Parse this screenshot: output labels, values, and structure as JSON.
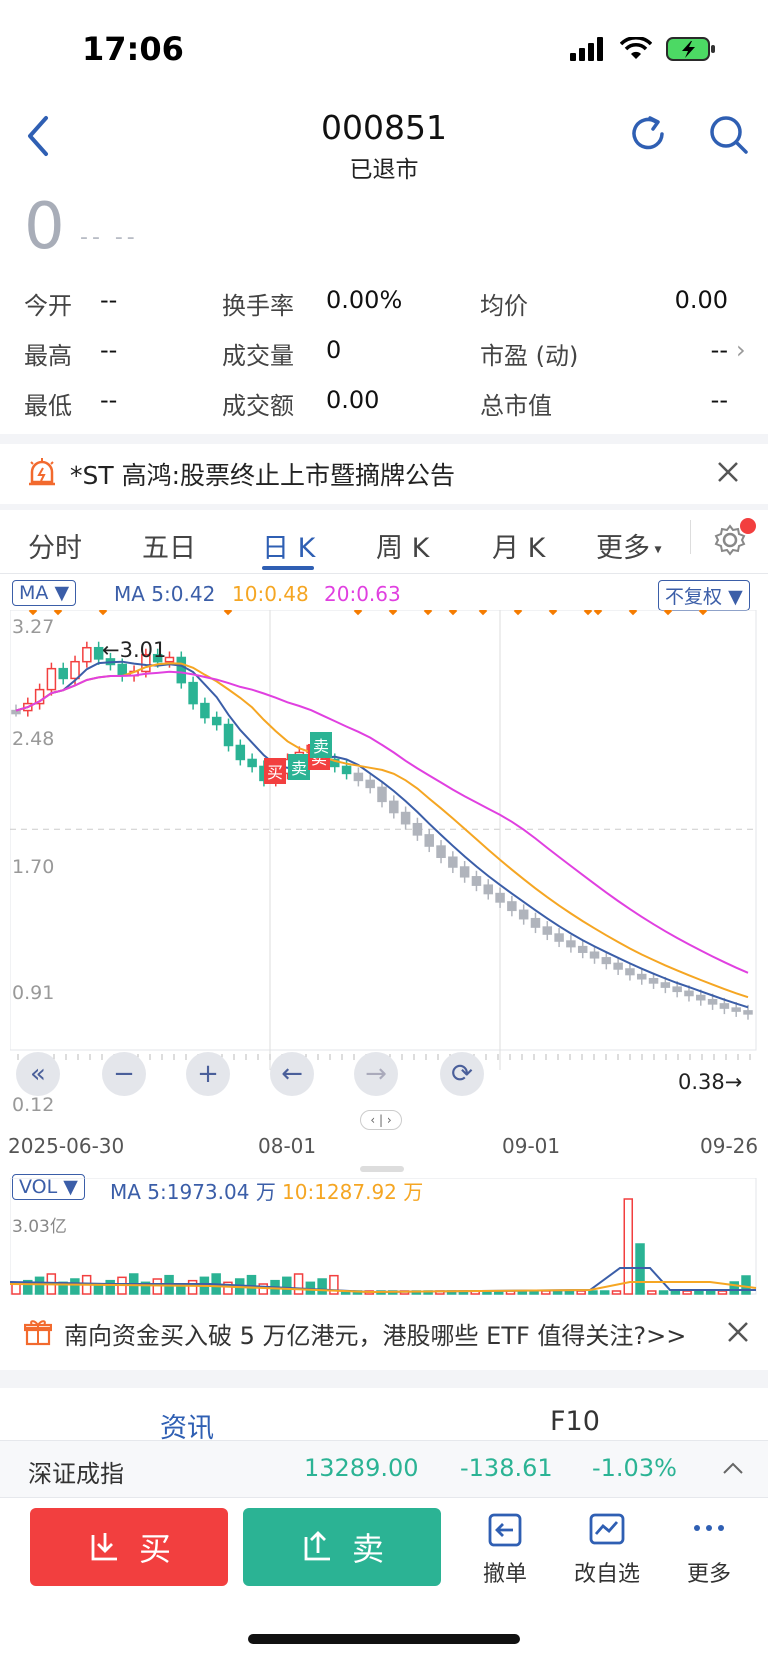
{
  "status": {
    "time": "17:06"
  },
  "header": {
    "code": "000851",
    "status": "已退市"
  },
  "quote": {
    "price": "0",
    "change": "-- --",
    "stats": [
      {
        "label": "今开",
        "value": "--"
      },
      {
        "label": "换手率",
        "value": "0.00%"
      },
      {
        "label": "均价",
        "value": "0.00"
      },
      {
        "label": "最高",
        "value": "--"
      },
      {
        "label": "成交量",
        "value": "0"
      },
      {
        "label": "市盈 (动)",
        "value": "--"
      },
      {
        "label": "最低",
        "value": "--"
      },
      {
        "label": "成交额",
        "value": "0.00"
      },
      {
        "label": "总市值",
        "value": "--"
      }
    ]
  },
  "notice": {
    "text": "*ST 高鸿:股票终止上市暨摘牌公告"
  },
  "tabs": [
    "分时",
    "五日",
    "日 K",
    "周 K",
    "月 K",
    "更多"
  ],
  "active_tab": "日 K",
  "chart": {
    "indicator": "MA",
    "ma5_label": "MA 5:0.42",
    "ma10_label": "10:0.48",
    "ma20_label": "20:0.63",
    "adjust": "不复权",
    "y_ticks": [
      "3.27",
      "2.48",
      "1.70",
      "0.91",
      "0.12"
    ],
    "x_ticks": [
      "2025-06-30",
      "08-01",
      "09-01",
      "09-26"
    ],
    "high_marker": "←3.01",
    "low_marker": "0.38→",
    "buy_tag": "买",
    "sell_tag": "卖",
    "colors": {
      "ma5": "#3b5ea8",
      "ma10": "#f5a623",
      "ma20": "#e040e0",
      "up": "#f23f3f",
      "down": "#2bb394",
      "flat": "#b0b4bc",
      "diamond": "#f57c00"
    }
  },
  "chart_data": {
    "type": "candlestick",
    "ylim": [
      0.12,
      3.27
    ],
    "series": [
      {
        "name": "MA 5",
        "last": 0.42
      },
      {
        "name": "MA 10",
        "last": 0.48
      },
      {
        "name": "MA 20",
        "last": 0.63
      }
    ],
    "high": 3.01,
    "low": 0.38,
    "close_series": [
      2.55,
      2.6,
      2.7,
      2.85,
      2.78,
      2.9,
      3.0,
      2.92,
      2.88,
      2.8,
      2.83,
      2.95,
      2.9,
      2.93,
      2.75,
      2.6,
      2.5,
      2.45,
      2.3,
      2.2,
      2.15,
      2.05,
      2.1,
      2.2,
      2.25,
      2.3,
      2.2,
      2.15,
      2.1,
      2.05,
      2.0,
      1.9,
      1.82,
      1.74,
      1.66,
      1.58,
      1.5,
      1.43,
      1.36,
      1.3,
      1.24,
      1.18,
      1.12,
      1.06,
      1.0,
      0.95,
      0.9,
      0.86,
      0.82,
      0.78,
      0.74,
      0.7,
      0.66,
      0.63,
      0.6,
      0.57,
      0.54,
      0.51,
      0.48,
      0.45,
      0.42,
      0.4,
      0.38
    ]
  },
  "volume": {
    "indicator": "VOL",
    "ma5_label": "MA 5:1973.04 万",
    "ma10_label": "10:1287.92 万",
    "y_max": "3.03亿"
  },
  "news": {
    "text": "南向资金买入破 5 万亿港元，港股哪些 ETF 值得关注?>>"
  },
  "sections": [
    "资讯",
    "F10"
  ],
  "index": {
    "name": "深证成指",
    "value": "13289.00",
    "change": "-138.61",
    "pct": "-1.03%"
  },
  "actions": {
    "buy": "买",
    "sell": "卖",
    "cancel": "撤单",
    "watch": "改自选",
    "more": "更多"
  }
}
